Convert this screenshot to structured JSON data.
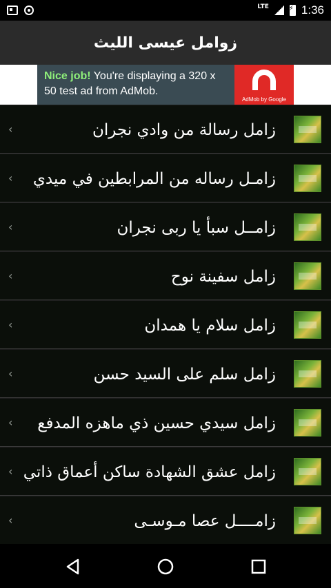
{
  "status": {
    "time": "1:36",
    "network": "LTE",
    "icons": [
      "sd-card-icon",
      "notification-icon",
      "signal-icon",
      "battery-charging-icon"
    ]
  },
  "app": {
    "title": "زوامل عيسى الليث"
  },
  "ad": {
    "headline": "Nice job!",
    "body": " You're displaying a 320 x 50 test ad from AdMob.",
    "logo_caption": "AdMob by Google",
    "logo_color": "#e02926"
  },
  "list": {
    "chevron": "‹",
    "items": [
      {
        "label": "زامل رسالة من وادي نجران"
      },
      {
        "label": "زامـل رساله من المرابطين في ميدي"
      },
      {
        "label": "زامــل سبأ يا ربى نجران"
      },
      {
        "label": "زامل سفينة نوح"
      },
      {
        "label": "زامل سلام يا همدان"
      },
      {
        "label": "زامل سلم على السيد حسن"
      },
      {
        "label": "زامل سيدي حسين ذي ماهزه المدفع"
      },
      {
        "label": "زامل عشق الشهادة ساكن أعماق ذاتي"
      },
      {
        "label": "زامــــل عصا مـوسـى"
      }
    ]
  },
  "nav": {
    "buttons": [
      "back-icon",
      "home-icon",
      "recents-icon"
    ]
  }
}
